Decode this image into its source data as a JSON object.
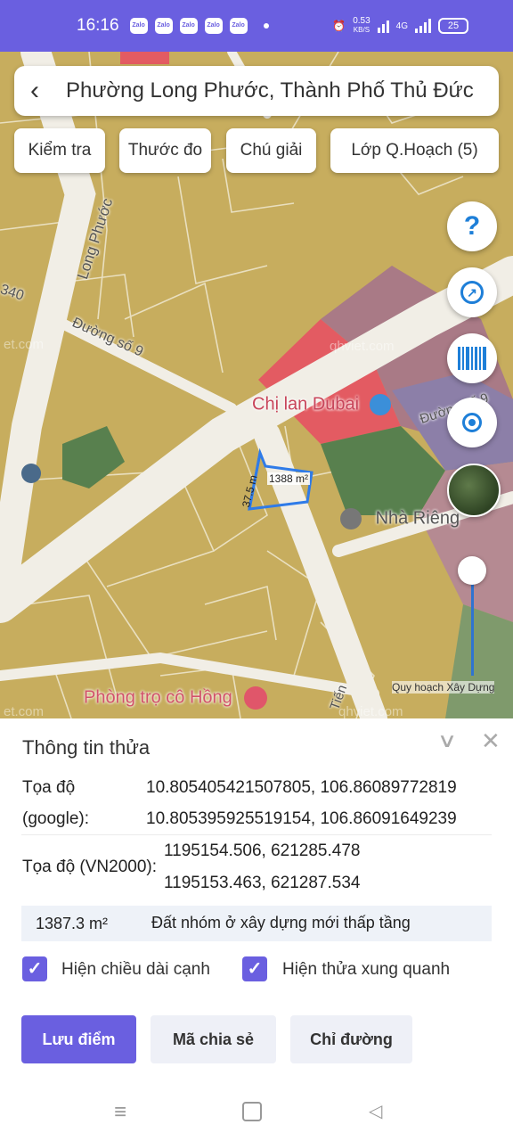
{
  "status_bar": {
    "time": "16:16",
    "notifications": [
      "Zalo",
      "Zalo",
      "Zalo",
      "Zalo",
      "Zalo"
    ],
    "net_speed_value": "0.53",
    "net_speed_unit": "KB/S",
    "network_type": "4G",
    "battery": "25"
  },
  "header": {
    "back_icon": "chevron-left-icon",
    "location_title": "Phường Long Phước, Thành Phố Thủ Đức"
  },
  "toolbar": {
    "check_label": "Kiểm tra",
    "measure_label": "Thước đo",
    "legend_label": "Chú giải",
    "layers_label": "Lớp Q.Hoạch (5)"
  },
  "map": {
    "labels": {
      "poi_1": "Chị lan Dubai",
      "poi_2": "Nhà Riêng",
      "poi_3": "Phòng trọ cô Hồng",
      "street_1": "Long Phước",
      "street_2": "Đường số 9",
      "street_3": "340",
      "street_4": "Đường số 9",
      "street_5": "Tiến"
    },
    "plot_area_label": "1388 m²",
    "plot_edge_label": "37.5 m",
    "watermarks": [
      "et.com",
      "qhviet.com",
      "et.com",
      "qhviet.com"
    ],
    "overlay_label": "Quy hoạch Xây Dựng",
    "overlay_opacity": 0.85,
    "controls": {
      "help_icon": "question-icon",
      "compass_icon": "compass-icon",
      "barcode_icon": "barcode-icon",
      "locate_icon": "crosshair-icon",
      "satellite_icon": "satellite-thumbnail-icon"
    },
    "colors": {
      "residential": "#c7ad5e",
      "commercial": "#e35b62",
      "mixed": "#a97a86",
      "green": "#58804e",
      "road": "#f1eee6"
    }
  },
  "parcel_info": {
    "title": "Thông tin thửa",
    "collapse_icon": "chevron-down-icon",
    "close_icon": "close-icon",
    "google_label_1": "Tọa độ",
    "google_label_2": "(google):",
    "google_coords": [
      "10.805405421507805, 106.86089772819",
      "10.805395925519154, 106.86091649239"
    ],
    "vn2000_label": "Tọa độ (VN2000):",
    "vn2000_coords": [
      "1195154.506, 621285.478",
      "1195153.463, 621287.534"
    ],
    "area": "1387.3 m²",
    "land_type": "Đất nhóm ở xây dựng mới thấp tầng",
    "show_edge_length": {
      "label": "Hiện chiều dài cạnh",
      "checked": true
    },
    "show_neighbors": {
      "label": "Hiện thửa xung quanh",
      "checked": true
    },
    "buttons": {
      "save": "Lưu điểm",
      "share": "Mã chia sẻ",
      "directions": "Chỉ đường"
    }
  },
  "nav_bar": {
    "menu_icon": "menu-icon",
    "home_icon": "home-square-icon",
    "back_icon": "back-triangle-icon"
  }
}
